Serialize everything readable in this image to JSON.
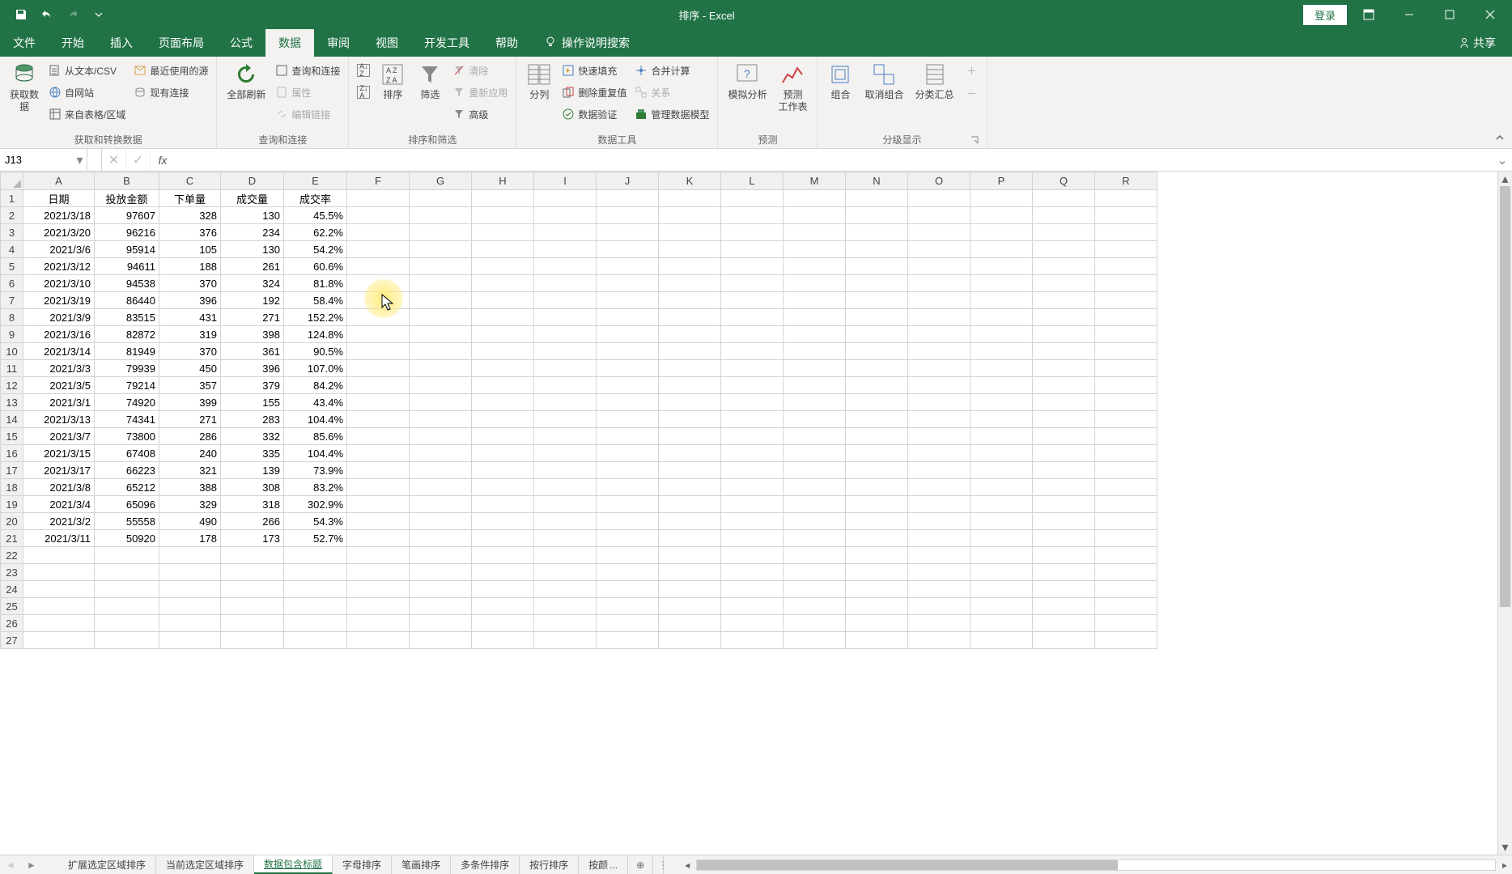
{
  "app": {
    "title": "排序 - Excel",
    "login": "登录"
  },
  "tabs": {
    "file": "文件",
    "home": "开始",
    "insert": "插入",
    "layout": "页面布局",
    "formulas": "公式",
    "data": "数据",
    "review": "审阅",
    "view": "视图",
    "dev": "开发工具",
    "help": "帮助",
    "tellme": "操作说明搜索",
    "share": "共享"
  },
  "ribbon": {
    "get_data": "获取数\n据",
    "from_csv": "从文本/CSV",
    "from_web": "自网站",
    "from_table": "来自表格/区域",
    "recent": "最近使用的源",
    "existing": "现有连接",
    "group1": "获取和转换数据",
    "refresh_all": "全部刷新",
    "queries": "查询和连接",
    "properties": "属性",
    "edit_links": "编辑链接",
    "group2": "查询和连接",
    "sort": "排序",
    "filter": "筛选",
    "clear": "清除",
    "reapply": "重新应用",
    "advanced": "高级",
    "group3": "排序和筛选",
    "text_to_cols": "分列",
    "flash_fill": "快速填充",
    "remove_dup": "删除重复值",
    "validation": "数据验证",
    "consolidate": "合并计算",
    "relations": "关系",
    "data_model": "管理数据模型",
    "group4": "数据工具",
    "whatif": "模拟分析",
    "forecast": "预测\n工作表",
    "group5": "预测",
    "group": "组合",
    "ungroup": "取消组合",
    "subtotal": "分类汇总",
    "group6": "分级显示"
  },
  "namebox": "J13",
  "columns": [
    "A",
    "B",
    "C",
    "D",
    "E",
    "F",
    "G",
    "H",
    "I",
    "J",
    "K",
    "L",
    "M",
    "N",
    "O",
    "P",
    "Q",
    "R"
  ],
  "headers": {
    "A": "日期",
    "B": "投放金额",
    "C": "下单量",
    "D": "成交量",
    "E": "成交率"
  },
  "rows": [
    {
      "A": "2021/3/18",
      "B": "97607",
      "C": "328",
      "D": "130",
      "E": "45.5%"
    },
    {
      "A": "2021/3/20",
      "B": "96216",
      "C": "376",
      "D": "234",
      "E": "62.2%"
    },
    {
      "A": "2021/3/6",
      "B": "95914",
      "C": "105",
      "D": "130",
      "E": "54.2%"
    },
    {
      "A": "2021/3/12",
      "B": "94611",
      "C": "188",
      "D": "261",
      "E": "60.6%"
    },
    {
      "A": "2021/3/10",
      "B": "94538",
      "C": "370",
      "D": "324",
      "E": "81.8%"
    },
    {
      "A": "2021/3/19",
      "B": "86440",
      "C": "396",
      "D": "192",
      "E": "58.4%"
    },
    {
      "A": "2021/3/9",
      "B": "83515",
      "C": "431",
      "D": "271",
      "E": "152.2%"
    },
    {
      "A": "2021/3/16",
      "B": "82872",
      "C": "319",
      "D": "398",
      "E": "124.8%"
    },
    {
      "A": "2021/3/14",
      "B": "81949",
      "C": "370",
      "D": "361",
      "E": "90.5%"
    },
    {
      "A": "2021/3/3",
      "B": "79939",
      "C": "450",
      "D": "396",
      "E": "107.0%"
    },
    {
      "A": "2021/3/5",
      "B": "79214",
      "C": "357",
      "D": "379",
      "E": "84.2%"
    },
    {
      "A": "2021/3/1",
      "B": "74920",
      "C": "399",
      "D": "155",
      "E": "43.4%"
    },
    {
      "A": "2021/3/13",
      "B": "74341",
      "C": "271",
      "D": "283",
      "E": "104.4%"
    },
    {
      "A": "2021/3/7",
      "B": "73800",
      "C": "286",
      "D": "332",
      "E": "85.6%"
    },
    {
      "A": "2021/3/15",
      "B": "67408",
      "C": "240",
      "D": "335",
      "E": "104.4%"
    },
    {
      "A": "2021/3/17",
      "B": "66223",
      "C": "321",
      "D": "139",
      "E": "73.9%"
    },
    {
      "A": "2021/3/8",
      "B": "65212",
      "C": "388",
      "D": "308",
      "E": "83.2%"
    },
    {
      "A": "2021/3/4",
      "B": "65096",
      "C": "329",
      "D": "318",
      "E": "302.9%"
    },
    {
      "A": "2021/3/2",
      "B": "55558",
      "C": "490",
      "D": "266",
      "E": "54.3%"
    },
    {
      "A": "2021/3/11",
      "B": "50920",
      "C": "178",
      "D": "173",
      "E": "52.7%"
    }
  ],
  "sheet_tabs": {
    "expand": "扩展选定区域排序",
    "current": "当前选定区域排序",
    "header": "数据包含标题",
    "alpha": "字母排序",
    "stroke": "笔画排序",
    "multi": "多条件排序",
    "byrow": "按行排序",
    "bycolor": "按颜",
    "more": "..."
  },
  "chart_data": {
    "type": "table",
    "columns": [
      "日期",
      "投放金额",
      "下单量",
      "成交量",
      "成交率"
    ],
    "data": [
      [
        "2021/3/18",
        97607,
        328,
        130,
        "45.5%"
      ],
      [
        "2021/3/20",
        96216,
        376,
        234,
        "62.2%"
      ],
      [
        "2021/3/6",
        95914,
        105,
        130,
        "54.2%"
      ],
      [
        "2021/3/12",
        94611,
        188,
        261,
        "60.6%"
      ],
      [
        "2021/3/10",
        94538,
        370,
        324,
        "81.8%"
      ],
      [
        "2021/3/19",
        86440,
        396,
        192,
        "58.4%"
      ],
      [
        "2021/3/9",
        83515,
        431,
        271,
        "152.2%"
      ],
      [
        "2021/3/16",
        82872,
        319,
        398,
        "124.8%"
      ],
      [
        "2021/3/14",
        81949,
        370,
        361,
        "90.5%"
      ],
      [
        "2021/3/3",
        79939,
        450,
        396,
        "107.0%"
      ],
      [
        "2021/3/5",
        79214,
        357,
        379,
        "84.2%"
      ],
      [
        "2021/3/1",
        74920,
        399,
        155,
        "43.4%"
      ],
      [
        "2021/3/13",
        74341,
        271,
        283,
        "104.4%"
      ],
      [
        "2021/3/7",
        73800,
        286,
        332,
        "85.6%"
      ],
      [
        "2021/3/15",
        67408,
        240,
        335,
        "104.4%"
      ],
      [
        "2021/3/17",
        66223,
        321,
        139,
        "73.9%"
      ],
      [
        "2021/3/8",
        65212,
        388,
        308,
        "83.2%"
      ],
      [
        "2021/3/4",
        65096,
        329,
        318,
        "302.9%"
      ],
      [
        "2021/3/2",
        55558,
        490,
        266,
        "54.3%"
      ],
      [
        "2021/3/11",
        50920,
        178,
        173,
        "52.7%"
      ]
    ]
  }
}
